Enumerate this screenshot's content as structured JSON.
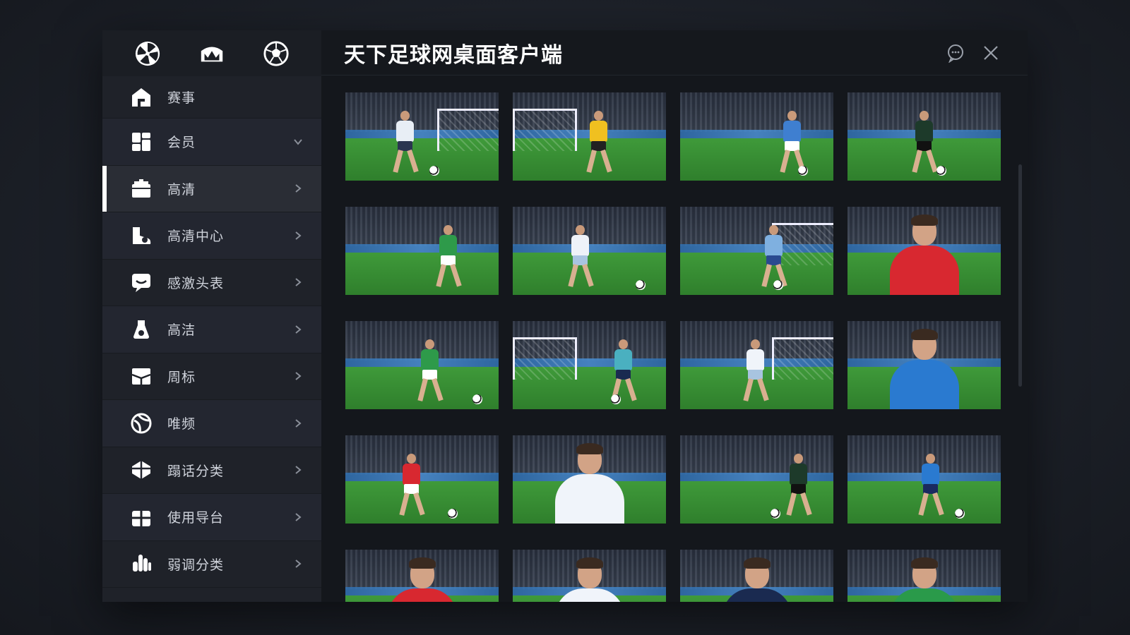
{
  "window": {
    "title": "天下足球网桌面客户端",
    "accent_color": "#ffffff",
    "background_color": "#15181e"
  },
  "sidebar": {
    "top_icons": [
      {
        "name": "aperture-icon"
      },
      {
        "name": "stadium-icon"
      },
      {
        "name": "football-icon"
      }
    ],
    "items": [
      {
        "label": "赛事",
        "icon": "home-icon",
        "arrow": "none"
      },
      {
        "label": "会员",
        "icon": "dashboard-icon",
        "arrow": "chevron-down"
      },
      {
        "label": "高清",
        "icon": "tv-icon",
        "arrow": "chevron-right",
        "active": true
      },
      {
        "label": "高清中心",
        "icon": "boot-icon",
        "arrow": "chevron-right"
      },
      {
        "label": "感激头表",
        "icon": "chat-icon",
        "arrow": "chevron-right"
      },
      {
        "label": "高洁",
        "icon": "bottle-icon",
        "arrow": "chevron-right"
      },
      {
        "label": "周标",
        "icon": "box-icon",
        "arrow": "chevron-right"
      },
      {
        "label": "唯频",
        "icon": "ball-icon",
        "arrow": "chevron-right"
      },
      {
        "label": "蹋话分类",
        "icon": "trophy-icon",
        "arrow": "chevron-right"
      },
      {
        "label": "使用导台",
        "icon": "gift-icon",
        "arrow": "chevron-right"
      },
      {
        "label": "弱调分类",
        "icon": "hand-icon",
        "arrow": "chevron-right"
      }
    ]
  },
  "header": {
    "buttons": [
      {
        "name": "chat-icon"
      },
      {
        "name": "close-icon"
      }
    ]
  },
  "gallery": {
    "thumbnails": [
      {
        "type": "action",
        "shirt": "#e8eef5",
        "shorts": "#2a3550",
        "goal": true
      },
      {
        "type": "goal",
        "shirt": "#f0c020",
        "shorts": "#222222",
        "goal": true
      },
      {
        "type": "action",
        "shirt": "#3f7fd0",
        "shorts": "#ffffff",
        "goal": false
      },
      {
        "type": "action",
        "shirt": "#1d3a2a",
        "shorts": "#111111",
        "goal": false
      },
      {
        "type": "action",
        "shirt": "#2e9a4a",
        "shorts": "#ffffff",
        "goal": false
      },
      {
        "type": "action",
        "shirt": "#eef2f8",
        "shorts": "#a8c4e0",
        "goal": false
      },
      {
        "type": "action",
        "shirt": "#7fb0e0",
        "shorts": "#2a4a90",
        "goal": true
      },
      {
        "type": "portrait",
        "shirt": "#d82830"
      },
      {
        "type": "action",
        "shirt": "#2e9a4a",
        "shorts": "#ffffff",
        "goal": false
      },
      {
        "type": "action",
        "shirt": "#4ab0c0",
        "shorts": "#1a2a50",
        "goal": true
      },
      {
        "type": "action",
        "shirt": "#f0f4fa",
        "shorts": "#a8c4e0",
        "goal": true
      },
      {
        "type": "portrait",
        "shirt": "#2a7ad0"
      },
      {
        "type": "action",
        "shirt": "#d82830",
        "shorts": "#ffffff",
        "goal": false
      },
      {
        "type": "portrait",
        "shirt": "#f0f4fa"
      },
      {
        "type": "action",
        "shirt": "#1d3a2a",
        "shorts": "#111111",
        "goal": false
      },
      {
        "type": "action",
        "shirt": "#2a7ad0",
        "shorts": "#1a2a60",
        "goal": false
      },
      {
        "type": "portrait",
        "shirt": "#d82830"
      },
      {
        "type": "portrait",
        "shirt": "#f0f4fa"
      },
      {
        "type": "portrait",
        "shirt": "#1a2a50"
      },
      {
        "type": "portrait",
        "shirt": "#2a9a4a"
      }
    ]
  }
}
